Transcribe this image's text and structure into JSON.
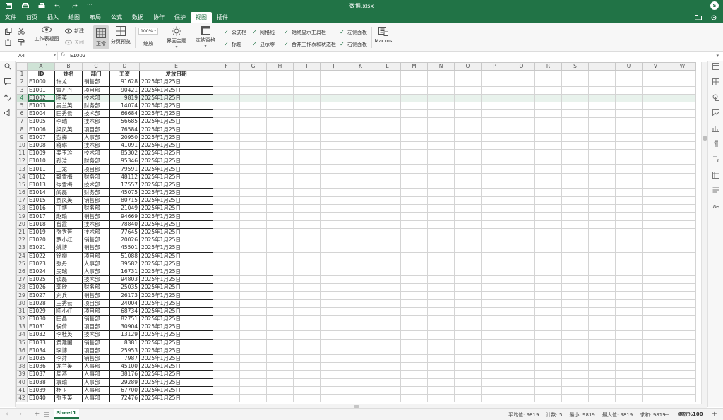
{
  "window": {
    "title": "数据.xlsx",
    "avatar_letter": "S"
  },
  "menu": {
    "items": [
      "文件",
      "首页",
      "插入",
      "绘图",
      "布局",
      "公式",
      "数据",
      "协作",
      "保护",
      "视图",
      "插件"
    ],
    "active_index": 9
  },
  "ribbon": {
    "sheet_view": "工作表视图",
    "new_label": "新建",
    "close_label": "关闭",
    "normal_label": "正常",
    "page_break_label": "分页预览",
    "zoom_value": "100%",
    "zoom_label": "缩放",
    "theme_label": "界面主题",
    "freeze_label": "冻结窗格",
    "checks": [
      "公式栏",
      "网格线",
      "始终显示工具栏",
      "左侧面板",
      "标题",
      "显示零",
      "合并工作表和状态栏",
      "右侧面板"
    ],
    "macros_label": "Macros"
  },
  "formula_bar": {
    "name_box": "A4",
    "fx": "fx",
    "value": "E1002"
  },
  "columns": [
    "A",
    "B",
    "C",
    "D",
    "E",
    "F",
    "G",
    "H",
    "I",
    "J",
    "K",
    "L",
    "M",
    "N",
    "O",
    "P",
    "Q",
    "R",
    "S",
    "T",
    "U",
    "V",
    "W"
  ],
  "headers": [
    "ID",
    "姓名",
    "部门",
    "工资",
    "发放日期"
  ],
  "rows": [
    [
      "E1000",
      "许龙",
      "销售部",
      "91628",
      "2025年1月25日"
    ],
    [
      "E1001",
      "雷丹丹",
      "项目部",
      "90421",
      "2025年1月25日"
    ],
    [
      "E1002",
      "陈英",
      "技术部",
      "9819",
      "2025年1月25日"
    ],
    [
      "E1003",
      "吴兰英",
      "财务部",
      "14074",
      "2025年1月25日"
    ],
    [
      "E1004",
      "田秀云",
      "技术部",
      "66684",
      "2025年1月25日"
    ],
    [
      "E1005",
      "李瑞",
      "技术部",
      "56685",
      "2025年1月25日"
    ],
    [
      "E1006",
      "梁凤英",
      "项目部",
      "76584",
      "2025年1月25日"
    ],
    [
      "E1007",
      "彭梅",
      "人事部",
      "20950",
      "2025年1月25日"
    ],
    [
      "E1008",
      "蒋琳",
      "技术部",
      "41091",
      "2025年1月25日"
    ],
    [
      "E1009",
      "姜玉珍",
      "技术部",
      "85302",
      "2025年1月25日"
    ],
    [
      "E1010",
      "孙洁",
      "财务部",
      "95346",
      "2025年1月25日"
    ],
    [
      "E1011",
      "王龙",
      "项目部",
      "79591",
      "2025年1月25日"
    ],
    [
      "E1012",
      "魏雪梅",
      "财务部",
      "48112",
      "2025年1月25日"
    ],
    [
      "E1013",
      "岑雪梅",
      "技术部",
      "17557",
      "2025年1月25日"
    ],
    [
      "E1014",
      "阎磊",
      "财务部",
      "45075",
      "2025年1月25日"
    ],
    [
      "E1015",
      "贾凤英",
      "销售部",
      "80715",
      "2025年1月25日"
    ],
    [
      "E1016",
      "丁博",
      "财务部",
      "21049",
      "2025年1月25日"
    ],
    [
      "E1017",
      "赵瑜",
      "销售部",
      "94669",
      "2025年1月25日"
    ],
    [
      "E1018",
      "曾霞",
      "技术部",
      "78840",
      "2025年1月25日"
    ],
    [
      "E1019",
      "张秀芳",
      "技术部",
      "77645",
      "2025年1月25日"
    ],
    [
      "E1020",
      "罗小红",
      "销售部",
      "20026",
      "2025年1月25日"
    ],
    [
      "E1021",
      "姚博",
      "销售部",
      "45501",
      "2025年1月25日"
    ],
    [
      "E1022",
      "徐柳",
      "项目部",
      "51088",
      "2025年1月25日"
    ],
    [
      "E1023",
      "张丹",
      "人事部",
      "39582",
      "2025年1月25日"
    ],
    [
      "E1024",
      "吴瑞",
      "人事部",
      "16731",
      "2025年1月25日"
    ],
    [
      "E1025",
      "谈磊",
      "技术部",
      "94803",
      "2025年1月25日"
    ],
    [
      "E1026",
      "郭欣",
      "财务部",
      "25035",
      "2025年1月25日"
    ],
    [
      "E1027",
      "刘兵",
      "销售部",
      "26173",
      "2025年1月25日"
    ],
    [
      "E1028",
      "王秀云",
      "项目部",
      "24004",
      "2025年1月25日"
    ],
    [
      "E1029",
      "陈小红",
      "项目部",
      "68734",
      "2025年1月25日"
    ],
    [
      "E1030",
      "田晶",
      "销售部",
      "82751",
      "2025年1月25日"
    ],
    [
      "E1031",
      "侯倩",
      "项目部",
      "30904",
      "2025年1月25日"
    ],
    [
      "E1032",
      "李桂英",
      "技术部",
      "13129",
      "2025年1月25日"
    ],
    [
      "E1033",
      "黄建国",
      "销售部",
      "8381",
      "2025年1月25日"
    ],
    [
      "E1034",
      "李博",
      "项目部",
      "25953",
      "2025年1月25日"
    ],
    [
      "E1035",
      "李萍",
      "销售部",
      "7987",
      "2025年1月25日"
    ],
    [
      "E1036",
      "龙兰英",
      "人事部",
      "45100",
      "2025年1月25日"
    ],
    [
      "E1037",
      "周燕",
      "人事部",
      "38176",
      "2025年1月25日"
    ],
    [
      "E1038",
      "袁瑜",
      "人事部",
      "29289",
      "2025年1月25日"
    ],
    [
      "E1039",
      "杨玉",
      "人事部",
      "67700",
      "2025年1月25日"
    ],
    [
      "E1040",
      "张玉英",
      "人事部",
      "72476",
      "2025年1月25日"
    ]
  ],
  "status": {
    "sheet_tab": "Sheet1",
    "average": "平均值: 9819",
    "count": "计数: 5",
    "min": "最小: 9819",
    "max": "最大值: 9819",
    "sum": "求和: 9819",
    "zoom_minus": "—",
    "zoom": "缩放%100",
    "zoom_plus": "+"
  },
  "colors": {
    "brand": "#217346"
  }
}
